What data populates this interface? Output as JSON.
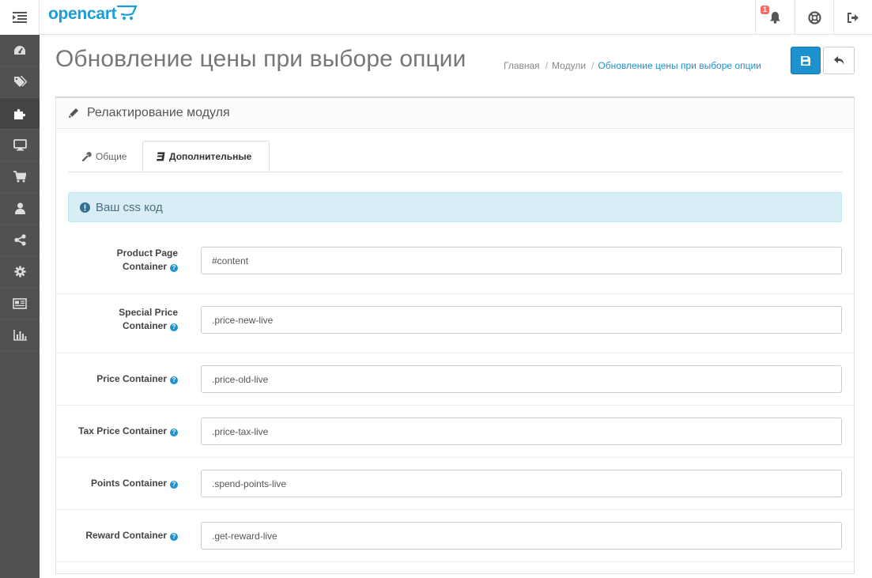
{
  "header": {
    "logo": "opencart",
    "notification_count": "1"
  },
  "sidebar": {
    "items": [
      {
        "icon": "dashboard-icon"
      },
      {
        "icon": "tags-icon"
      },
      {
        "icon": "puzzle-icon",
        "active": true
      },
      {
        "icon": "desktop-icon"
      },
      {
        "icon": "cart-icon"
      },
      {
        "icon": "user-icon"
      },
      {
        "icon": "share-icon"
      },
      {
        "icon": "cog-icon"
      },
      {
        "icon": "newspaper-icon"
      },
      {
        "icon": "bar-chart-icon"
      }
    ]
  },
  "page": {
    "title": "Обновление цены при выборе опции",
    "breadcrumb": [
      "Главная",
      "Модули",
      "Обновление цены при выборе опции"
    ]
  },
  "panel": {
    "heading": "Релактирование модуля",
    "tabs": [
      {
        "label": "Общие"
      },
      {
        "label": "Дополнительные",
        "active": true
      }
    ],
    "alert": "Ваш css код",
    "fields": [
      {
        "label_line1": "Product Page",
        "label_line2": "Container",
        "value": "#content"
      },
      {
        "label_line1": "Special Price",
        "label_line2": "Container",
        "value": ".price-new-live"
      },
      {
        "label": "Price Container",
        "value": ".price-old-live"
      },
      {
        "label": "Tax Price Container",
        "value": ".price-tax-live"
      },
      {
        "label": "Points Container",
        "value": ".spend-points-live"
      },
      {
        "label": "Reward Container",
        "value": ".get-reward-live"
      }
    ]
  },
  "colors": {
    "brand": "#1b9dd9",
    "primary_button": "#1e91cf",
    "sidebar_bg": "#515151",
    "alert_bg": "#d9edf7",
    "badge": "#f56b6b"
  }
}
